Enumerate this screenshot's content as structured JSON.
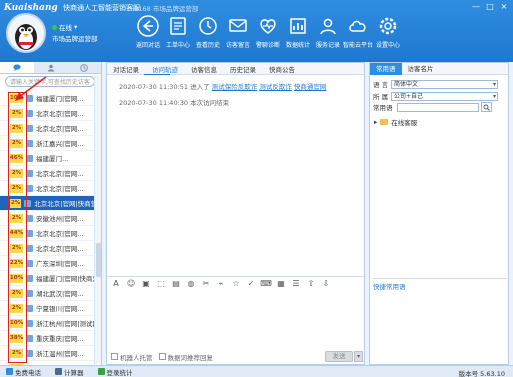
{
  "app": {
    "logo": "Kuaishang",
    "title": "快商通人工智能营销客服",
    "subtitle": "168168 市场品牌运营部",
    "window_controls": [
      "—",
      "□",
      "×"
    ]
  },
  "user": {
    "status": "在线",
    "status_color": "#39c54b",
    "department": "市场品牌运营部"
  },
  "nav": [
    {
      "label": "返回对话",
      "icon": "back-arrow-icon"
    },
    {
      "label": "工单中心",
      "icon": "ticket-icon"
    },
    {
      "label": "查看历史",
      "icon": "history-icon"
    },
    {
      "label": "访客留言",
      "icon": "message-icon"
    },
    {
      "label": "警聊诊断",
      "icon": "diagnosis-icon"
    },
    {
      "label": "数据统计",
      "icon": "chart-icon"
    },
    {
      "label": "服务记录",
      "icon": "record-icon"
    },
    {
      "label": "智能云平台",
      "icon": "cloud-icon"
    },
    {
      "label": "设置中心",
      "icon": "gear-icon"
    }
  ],
  "left": {
    "search_placeholder": "请输入关键字,可查找历史访客",
    "visitors": [
      {
        "pct": "10%",
        "name": "福建厦门|官网..."
      },
      {
        "pct": "2%",
        "name": "北京北京|官网..."
      },
      {
        "pct": "2%",
        "name": "北京北京|官网..."
      },
      {
        "pct": "2%",
        "name": "浙江嘉兴|官网..."
      },
      {
        "pct": "46%",
        "name": "福建厦门..."
      },
      {
        "pct": "2%",
        "name": "北京北京|官网..."
      },
      {
        "pct": "2%",
        "name": "北京北京|官网..."
      },
      {
        "pct": "2%",
        "name": "北京北京|官网|快商营..."
      },
      {
        "pct": "2%",
        "name": "安徽池州|官网..."
      },
      {
        "pct": "44%",
        "name": "北京北京|官网..."
      },
      {
        "pct": "2%",
        "name": "北京北京|官网..."
      },
      {
        "pct": "22%",
        "name": "广东深圳|官网..."
      },
      {
        "pct": "10%",
        "name": "福建厦门|官网|快商营..."
      },
      {
        "pct": "2%",
        "name": "湖北武汉|官网..."
      },
      {
        "pct": "2%",
        "name": "宁夏银川|官网..."
      },
      {
        "pct": "10%",
        "name": "浙江杭州|官网|测试网..."
      },
      {
        "pct": "38%",
        "name": "重庆重庆|官网..."
      },
      {
        "pct": "2%",
        "name": "浙江温州|官网..."
      },
      {
        "pct": "22%",
        "name": "北京北京|官网-373"
      }
    ],
    "selected_index": 7
  },
  "main": {
    "tabs": [
      "对话记录",
      "访问轨迹",
      "访客信息",
      "历史记录",
      "快商公告"
    ],
    "active_tab": 1,
    "chat": [
      {
        "time": "2020-07-30 11:30:51",
        "prefix": "进入了",
        "links": [
          "测试保险反欺诈",
          "测试反欺诈",
          "快商通官网"
        ]
      },
      {
        "time": "2020-07-30 11:40:30",
        "text": "本次访问结束"
      }
    ],
    "toolbar_icons": [
      "font-icon",
      "emoji-icon",
      "image-icon",
      "screenshot-icon",
      "file-icon",
      "chat-bubble-icon",
      "scissors-icon",
      "cut-icon",
      "star-icon",
      "check-icon",
      "keyboard-icon",
      "grid-icon",
      "list-icon",
      "arrow-up-icon",
      "arrow-down-icon"
    ],
    "robot_label": "机器人托管",
    "recommend_label": "数据词推荐回复",
    "send_label": "发送"
  },
  "right": {
    "tabs": [
      "常用语",
      "访客名片"
    ],
    "active_tab": 0,
    "language_label": "语 言",
    "language_value": "简体中文",
    "owner_label": "所 属",
    "owner_value": "公司+自己",
    "phrase_label": "常用语",
    "tree_item": "在线客服",
    "quick_label": "快捷常用语"
  },
  "statusbar": {
    "items": [
      "免费电话",
      "计算器",
      "登录统计"
    ],
    "version": "版本号 5.63.10"
  }
}
